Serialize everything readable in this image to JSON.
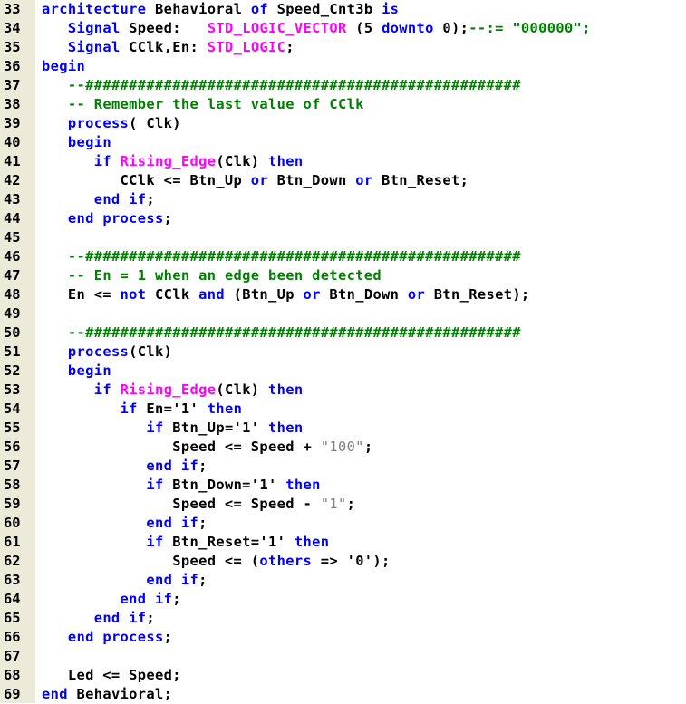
{
  "colors": {
    "gutter_bg": "#ecebd9",
    "keyword": "#0000ff",
    "type": "#ff00ff",
    "string": "#808080",
    "comment": "#008000",
    "text": "#000000"
  },
  "lines": [
    {
      "num": "33",
      "tokens": [
        [
          "kw",
          "architecture"
        ],
        [
          "plain",
          " Behavioral "
        ],
        [
          "kw",
          "of"
        ],
        [
          "plain",
          " Speed_Cnt3b "
        ],
        [
          "kw",
          "is"
        ]
      ]
    },
    {
      "num": "34",
      "tokens": [
        [
          "plain",
          "   "
        ],
        [
          "kw",
          "Signal"
        ],
        [
          "plain",
          " Speed:   "
        ],
        [
          "type",
          "STD_LOGIC_VECTOR"
        ],
        [
          "plain",
          " (5 "
        ],
        [
          "kw",
          "downto"
        ],
        [
          "plain",
          " 0);"
        ],
        [
          "comment",
          "--:= \"000000\";"
        ]
      ]
    },
    {
      "num": "35",
      "tokens": [
        [
          "plain",
          "   "
        ],
        [
          "kw",
          "Signal"
        ],
        [
          "plain",
          " CClk,En: "
        ],
        [
          "type",
          "STD_LOGIC"
        ],
        [
          "plain",
          ";"
        ]
      ]
    },
    {
      "num": "36",
      "tokens": [
        [
          "kw",
          "begin"
        ]
      ]
    },
    {
      "num": "37",
      "tokens": [
        [
          "plain",
          "   "
        ],
        [
          "comment",
          "--##################################################"
        ]
      ]
    },
    {
      "num": "38",
      "tokens": [
        [
          "plain",
          "   "
        ],
        [
          "comment",
          "-- Remember the last value of CClk"
        ]
      ]
    },
    {
      "num": "39",
      "tokens": [
        [
          "plain",
          "   "
        ],
        [
          "kw",
          "process"
        ],
        [
          "plain",
          "( Clk)"
        ]
      ]
    },
    {
      "num": "40",
      "tokens": [
        [
          "plain",
          "   "
        ],
        [
          "kw",
          "begin"
        ]
      ]
    },
    {
      "num": "41",
      "tokens": [
        [
          "plain",
          "      "
        ],
        [
          "kw",
          "if"
        ],
        [
          "plain",
          " "
        ],
        [
          "fn",
          "Rising_Edge"
        ],
        [
          "plain",
          "(Clk) "
        ],
        [
          "kw",
          "then"
        ]
      ]
    },
    {
      "num": "42",
      "tokens": [
        [
          "plain",
          "         CClk <= Btn_Up "
        ],
        [
          "kw",
          "or"
        ],
        [
          "plain",
          " Btn_Down "
        ],
        [
          "kw",
          "or"
        ],
        [
          "plain",
          " Btn_Reset;"
        ]
      ]
    },
    {
      "num": "43",
      "tokens": [
        [
          "plain",
          "      "
        ],
        [
          "kw",
          "end if"
        ],
        [
          "plain",
          ";"
        ]
      ]
    },
    {
      "num": "44",
      "tokens": [
        [
          "plain",
          "   "
        ],
        [
          "kw",
          "end process"
        ],
        [
          "plain",
          ";"
        ]
      ]
    },
    {
      "num": "45",
      "tokens": []
    },
    {
      "num": "46",
      "tokens": [
        [
          "plain",
          "   "
        ],
        [
          "comment",
          "--##################################################"
        ]
      ]
    },
    {
      "num": "47",
      "tokens": [
        [
          "plain",
          "   "
        ],
        [
          "comment",
          "-- En = 1 when an edge been detected"
        ]
      ]
    },
    {
      "num": "48",
      "tokens": [
        [
          "plain",
          "   En <= "
        ],
        [
          "kw",
          "not"
        ],
        [
          "plain",
          " CClk "
        ],
        [
          "kw",
          "and"
        ],
        [
          "plain",
          " (Btn_Up "
        ],
        [
          "kw",
          "or"
        ],
        [
          "plain",
          " Btn_Down "
        ],
        [
          "kw",
          "or"
        ],
        [
          "plain",
          " Btn_Reset);"
        ]
      ]
    },
    {
      "num": "49",
      "tokens": []
    },
    {
      "num": "50",
      "tokens": [
        [
          "plain",
          "   "
        ],
        [
          "comment",
          "--##################################################"
        ]
      ]
    },
    {
      "num": "51",
      "tokens": [
        [
          "plain",
          "   "
        ],
        [
          "kw",
          "process"
        ],
        [
          "plain",
          "(Clk)"
        ]
      ]
    },
    {
      "num": "52",
      "tokens": [
        [
          "plain",
          "   "
        ],
        [
          "kw",
          "begin"
        ]
      ]
    },
    {
      "num": "53",
      "tokens": [
        [
          "plain",
          "      "
        ],
        [
          "kw",
          "if"
        ],
        [
          "plain",
          " "
        ],
        [
          "fn",
          "Rising_Edge"
        ],
        [
          "plain",
          "(Clk) "
        ],
        [
          "kw",
          "then"
        ]
      ]
    },
    {
      "num": "54",
      "tokens": [
        [
          "plain",
          "         "
        ],
        [
          "kw",
          "if"
        ],
        [
          "plain",
          " En='1' "
        ],
        [
          "kw",
          "then"
        ]
      ]
    },
    {
      "num": "55",
      "tokens": [
        [
          "plain",
          "            "
        ],
        [
          "kw",
          "if"
        ],
        [
          "plain",
          " Btn_Up='1' "
        ],
        [
          "kw",
          "then"
        ]
      ]
    },
    {
      "num": "56",
      "tokens": [
        [
          "plain",
          "               Speed <= Speed + "
        ],
        [
          "str",
          "\"100\""
        ],
        [
          "plain",
          ";"
        ]
      ]
    },
    {
      "num": "57",
      "tokens": [
        [
          "plain",
          "            "
        ],
        [
          "kw",
          "end if"
        ],
        [
          "plain",
          ";"
        ]
      ]
    },
    {
      "num": "58",
      "tokens": [
        [
          "plain",
          "            "
        ],
        [
          "kw",
          "if"
        ],
        [
          "plain",
          " Btn_Down='1' "
        ],
        [
          "kw",
          "then"
        ]
      ]
    },
    {
      "num": "59",
      "tokens": [
        [
          "plain",
          "               Speed <= Speed - "
        ],
        [
          "str",
          "\"1\""
        ],
        [
          "plain",
          ";"
        ]
      ]
    },
    {
      "num": "60",
      "tokens": [
        [
          "plain",
          "            "
        ],
        [
          "kw",
          "end if"
        ],
        [
          "plain",
          ";"
        ]
      ]
    },
    {
      "num": "61",
      "tokens": [
        [
          "plain",
          "            "
        ],
        [
          "kw",
          "if"
        ],
        [
          "plain",
          " Btn_Reset='1' "
        ],
        [
          "kw",
          "then"
        ]
      ]
    },
    {
      "num": "62",
      "tokens": [
        [
          "plain",
          "               Speed <= ("
        ],
        [
          "kw",
          "others"
        ],
        [
          "plain",
          " => '0');"
        ]
      ]
    },
    {
      "num": "63",
      "tokens": [
        [
          "plain",
          "            "
        ],
        [
          "kw",
          "end if"
        ],
        [
          "plain",
          ";"
        ]
      ]
    },
    {
      "num": "64",
      "tokens": [
        [
          "plain",
          "         "
        ],
        [
          "kw",
          "end if"
        ],
        [
          "plain",
          ";"
        ]
      ]
    },
    {
      "num": "65",
      "tokens": [
        [
          "plain",
          "      "
        ],
        [
          "kw",
          "end if"
        ],
        [
          "plain",
          ";"
        ]
      ]
    },
    {
      "num": "66",
      "tokens": [
        [
          "plain",
          "   "
        ],
        [
          "kw",
          "end process"
        ],
        [
          "plain",
          ";"
        ]
      ]
    },
    {
      "num": "67",
      "tokens": []
    },
    {
      "num": "68",
      "tokens": [
        [
          "plain",
          "   Led <= Speed;"
        ]
      ]
    },
    {
      "num": "69",
      "tokens": [
        [
          "kw",
          "end"
        ],
        [
          "plain",
          " Behavioral;"
        ]
      ]
    }
  ]
}
